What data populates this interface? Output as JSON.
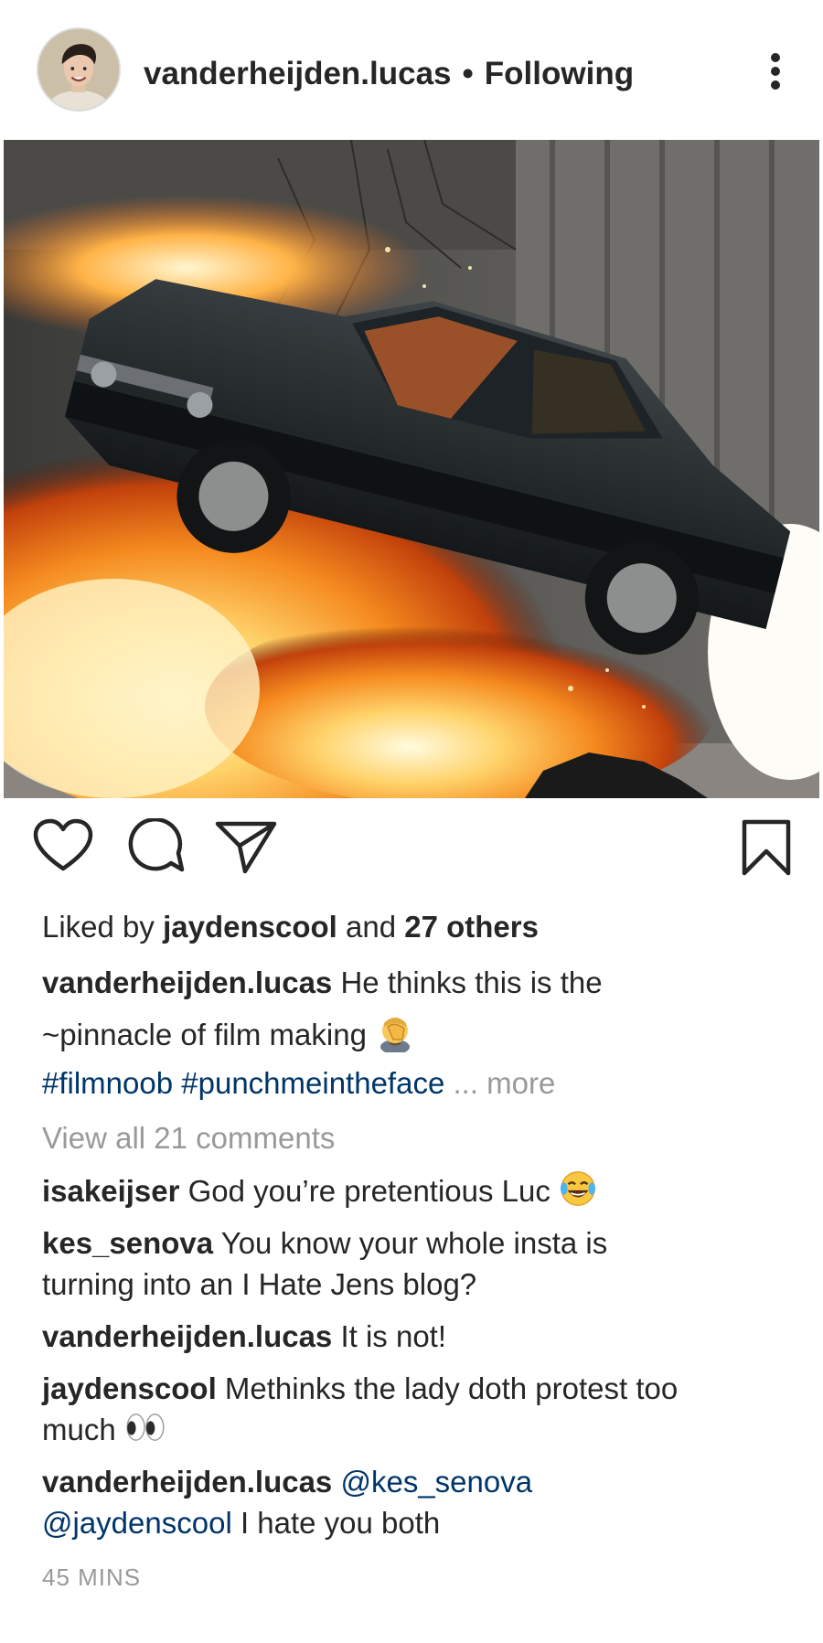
{
  "post": {
    "username": "vanderheijden.lucas",
    "separator": "•",
    "follow_status": "Following",
    "more_icon": "vertical-dots-icon"
  },
  "actions": {
    "icons": [
      "heart-icon",
      "comment-icon",
      "share-icon",
      "bookmark-icon"
    ]
  },
  "likes": {
    "prefix": "Liked by",
    "user": "jaydenscool",
    "middle": "and",
    "count_text": "27 others"
  },
  "caption": {
    "username": "vanderheijden.lucas",
    "text_line1": "He thinks this is the",
    "text_line2": "~pinnacle of film making",
    "emoji_icon": "face-palm-emoji",
    "hashtag1": "#filmnoob",
    "hashtag2": "#punchmeintheface",
    "ellipsis": "...",
    "more": "more"
  },
  "view_comments": "View all 21 comments",
  "comments": [
    {
      "user": "isakeijser",
      "text": "God you’re pretentious Luc",
      "emoji_icon": "laughing-tears-emoji"
    },
    {
      "user": "kes_senova",
      "text_line1": "You know your whole insta is",
      "text_line2": "turning into an I Hate Jens blog?"
    },
    {
      "user": "vanderheijden.lucas",
      "text": "It is not!"
    },
    {
      "user": "jaydenscool",
      "text_line1": "Methinks the lady doth protest too",
      "text_line2": "much",
      "emoji_icon": "eyes-emoji"
    },
    {
      "user": "vanderheijden.lucas",
      "mention1": "@kes_senova",
      "mention2": "@jaydenscool",
      "text": "I hate you both"
    }
  ],
  "timestamp": "45 MINS",
  "colors": {
    "link": "#003569",
    "muted": "#999999",
    "text": "#262626"
  }
}
